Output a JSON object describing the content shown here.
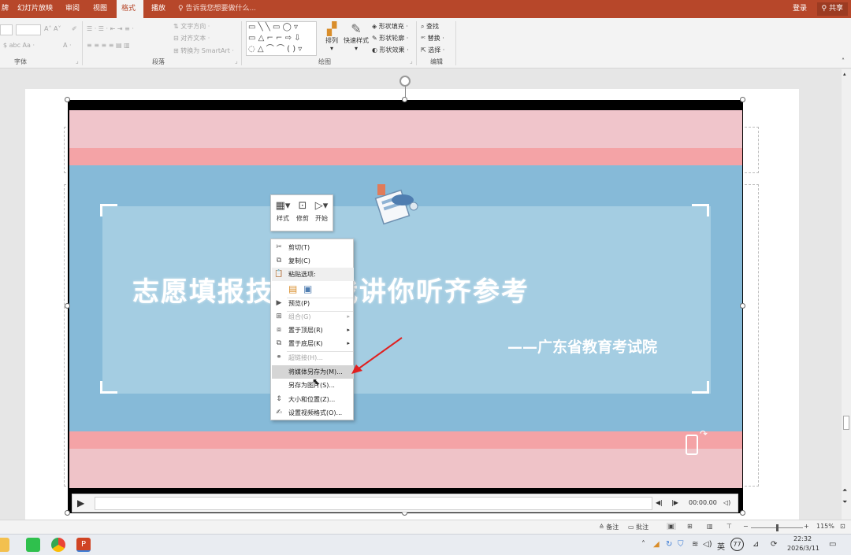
{
  "tabs": {
    "partial_left": "牌",
    "slideshow": "幻灯片放映",
    "review": "审阅",
    "view": "视图",
    "format": "格式",
    "playback": "播放",
    "tellme": "告诉我您想要做什么...",
    "login": "登录",
    "share": "共享"
  },
  "ribbon": {
    "font_group": "字体",
    "paragraph_group": "段落",
    "drawing_group": "绘图",
    "editing_group": "编辑",
    "text_direction": "文字方向",
    "align_text": "对齐文本",
    "convert_smartart": "转换为 SmartArt",
    "arrange": "排列",
    "quick_styles": "快速样式",
    "shape_fill": "形状填充",
    "shape_outline": "形状轮廓",
    "shape_effects": "形状效果",
    "find": "查找",
    "replace": "替换",
    "select": "选择"
  },
  "video": {
    "title": "志愿填报技巧，我讲你听齐参考",
    "subtitle": "——广东省教育考试院",
    "time": "00:00.00"
  },
  "mini_toolbar": {
    "style": "样式",
    "trim": "修剪",
    "start": "开始"
  },
  "context_menu": {
    "cut": "剪切(T)",
    "copy": "复制(C)",
    "paste_options": "粘贴选项:",
    "preview": "预览(P)",
    "group": "组合(G)",
    "bring_front": "置于顶层(R)",
    "send_back": "置于底层(K)",
    "hyperlink": "超链接(H)...",
    "save_media": "将媒体另存为(M)...",
    "save_picture": "另存为图片(S)...",
    "size_position": "大小和位置(Z)...",
    "format_video": "设置视频格式(O)..."
  },
  "status": {
    "notes": "备注",
    "comments": "批注",
    "zoom": "115%"
  },
  "taskbar": {
    "ime": "英",
    "badge": "77",
    "time": "22:32",
    "date": "2026/3/11"
  },
  "colors": {
    "accent": "#b7472a",
    "video_blue": "#86bad8",
    "video_pink": "#f4a3a6",
    "arrow": "#e02020"
  }
}
